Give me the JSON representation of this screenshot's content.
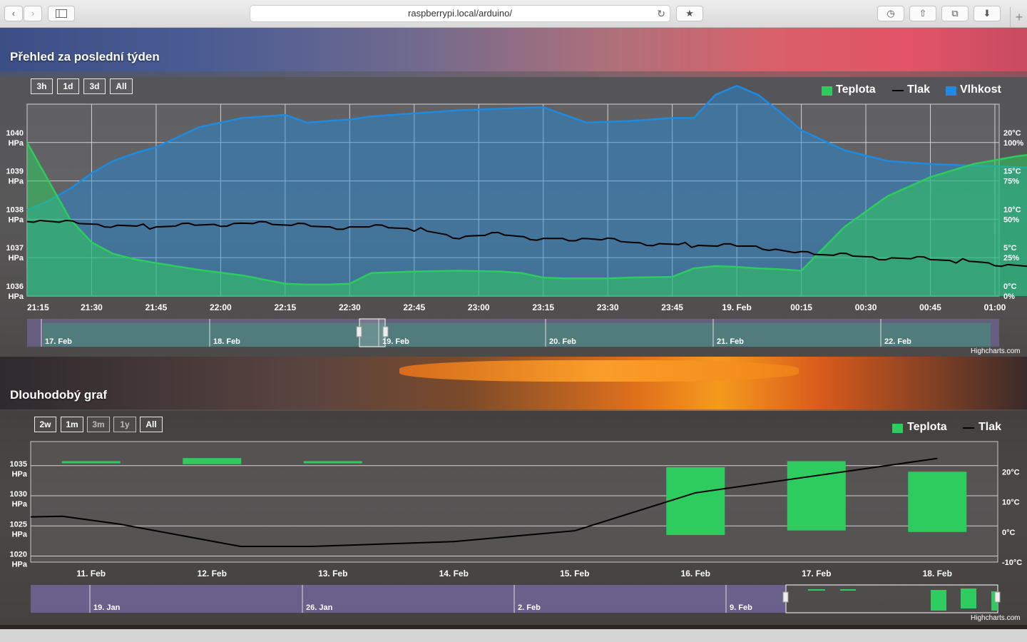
{
  "browser": {
    "url": "raspberrypi.local/arduino/"
  },
  "section1": {
    "title": "Přehled za poslední týden",
    "ranges": [
      "3h",
      "1d",
      "3d",
      "All"
    ],
    "credits": "Highcharts.com"
  },
  "section2": {
    "title": "Dlouhodobý graf",
    "ranges": [
      "2w",
      "1m",
      "3m",
      "1y",
      "All"
    ],
    "credits": "Highcharts.com"
  },
  "chart_data": [
    {
      "type": "line",
      "title": "Přehled za poslední týden",
      "x_ticks": [
        "21:15",
        "21:30",
        "21:45",
        "22:00",
        "22:15",
        "22:30",
        "22:45",
        "23:00",
        "23:15",
        "23:30",
        "23:45",
        "19. Feb",
        "00:15",
        "00:30",
        "00:45",
        "01:00"
      ],
      "y_left": {
        "ticks": [
          "1036",
          "1037",
          "1038",
          "1039",
          "1040"
        ],
        "unit": "HPa",
        "range": [
          1036,
          1041
        ]
      },
      "y_right_temp": {
        "ticks": [
          "0°C",
          "5°C",
          "10°C",
          "15°C",
          "20°C"
        ],
        "range": [
          0,
          25
        ]
      },
      "y_right_hum": {
        "ticks": [
          "0%",
          "25%",
          "50%",
          "75%",
          "100%"
        ],
        "range": [
          0,
          125
        ]
      },
      "legend": [
        {
          "name": "Teplota",
          "color": "#2ecc5f",
          "symbol": "area"
        },
        {
          "name": "Tlak",
          "color": "#000000",
          "symbol": "line"
        },
        {
          "name": "Vlhkost",
          "color": "#1e8be0",
          "symbol": "area"
        }
      ],
      "series": [
        {
          "name": "Teplota",
          "axis": "y_right_temp",
          "x_minutes": [
            0,
            5,
            10,
            15,
            20,
            25,
            30,
            40,
            50,
            60,
            65,
            70,
            75,
            80,
            90,
            100,
            110,
            115,
            120,
            125,
            130,
            135,
            140,
            150,
            155,
            160,
            165,
            170,
            175,
            180,
            190,
            200,
            210,
            220,
            230,
            240,
            250,
            260,
            270,
            285
          ],
          "values": [
            20,
            15,
            10,
            7,
            5.5,
            4.8,
            4.3,
            3.4,
            2.7,
            1.6,
            1.5,
            1.5,
            1.6,
            3,
            3.2,
            3.3,
            3.2,
            3,
            2.4,
            2.3,
            2.3,
            2.3,
            2.4,
            2.5,
            3.6,
            3.9,
            3.8,
            3.6,
            3.5,
            3.3,
            9,
            13,
            15.5,
            17.2,
            18.2,
            18.9,
            19.4,
            19.7,
            19.9,
            20.1
          ]
        },
        {
          "name": "Tlak",
          "axis": "y_left",
          "x_minutes": [
            0,
            10,
            20,
            30,
            40,
            50,
            60,
            70,
            80,
            90,
            100,
            110,
            120,
            130,
            140,
            150,
            160,
            170,
            180,
            190,
            200,
            210,
            220,
            230,
            240,
            250,
            260,
            270,
            285
          ],
          "values": [
            1038.0,
            1037.9,
            1037.85,
            1037.8,
            1037.85,
            1037.9,
            1037.85,
            1037.8,
            1037.8,
            1037.75,
            1037.55,
            1037.6,
            1037.5,
            1037.5,
            1037.4,
            1037.35,
            1037.3,
            1037.3,
            1037.1,
            1037.05,
            1037.0,
            1036.95,
            1036.9,
            1036.8,
            1036.7,
            1036.6,
            1036.5,
            1036.4,
            1036.2
          ]
        },
        {
          "name": "Vlhkost",
          "axis": "y_right_hum",
          "x_minutes": [
            0,
            5,
            10,
            15,
            20,
            25,
            30,
            40,
            50,
            60,
            65,
            70,
            75,
            80,
            90,
            100,
            110,
            120,
            130,
            140,
            150,
            155,
            160,
            165,
            170,
            175,
            180,
            190,
            200,
            210,
            220,
            230,
            240,
            250,
            260,
            270,
            285
          ],
          "values": [
            56,
            62,
            70,
            80,
            88,
            93,
            97,
            110,
            116,
            118,
            113,
            114,
            115,
            117,
            119,
            121,
            122,
            123,
            113,
            114,
            116,
            116,
            131,
            137,
            131,
            120,
            108,
            95,
            88,
            86,
            85,
            84,
            83,
            82,
            81,
            80.5,
            80
          ]
        }
      ],
      "navigator": {
        "labels": [
          "17. Feb",
          "18. Feb",
          "19. Feb",
          "20. Feb",
          "21. Feb",
          "22. Feb"
        ]
      }
    },
    {
      "type": "bar",
      "title": "Dlouhodobý graf",
      "categories": [
        "11. Feb",
        "12. Feb",
        "13. Feb",
        "14. Feb",
        "15. Feb",
        "16. Feb",
        "17. Feb",
        "18. Feb"
      ],
      "y_left": {
        "ticks": [
          "1020",
          "1025",
          "1030",
          "1035"
        ],
        "unit": "HPa",
        "range": [
          1019,
          1039
        ]
      },
      "y_right": {
        "ticks": [
          "-10°C",
          "0°C",
          "10°C",
          "20°C"
        ],
        "range": [
          -10,
          30
        ]
      },
      "legend": [
        {
          "name": "Teplota",
          "color": "#2ecc5f",
          "symbol": "column"
        },
        {
          "name": "Tlak",
          "color": "#000000",
          "symbol": "line"
        }
      ],
      "series": [
        {
          "name": "Teplota",
          "type": "columnrange",
          "low": [
            23,
            22.5,
            23,
            null,
            null,
            -1,
            0.5,
            0
          ],
          "high": [
            23.5,
            24.5,
            23.5,
            null,
            null,
            21.5,
            23.5,
            20
          ]
        },
        {
          "name": "Tlak",
          "type": "line",
          "values": [
            1026.5,
            1026.6,
            1025.3,
            1021.6,
            1021.6,
            1022.4,
            1024.2,
            1030.5,
            1036.2
          ]
        }
      ],
      "navigator": {
        "labels": [
          "19. Jan",
          "26. Jan",
          "2. Feb",
          "9. Feb"
        ]
      }
    }
  ]
}
